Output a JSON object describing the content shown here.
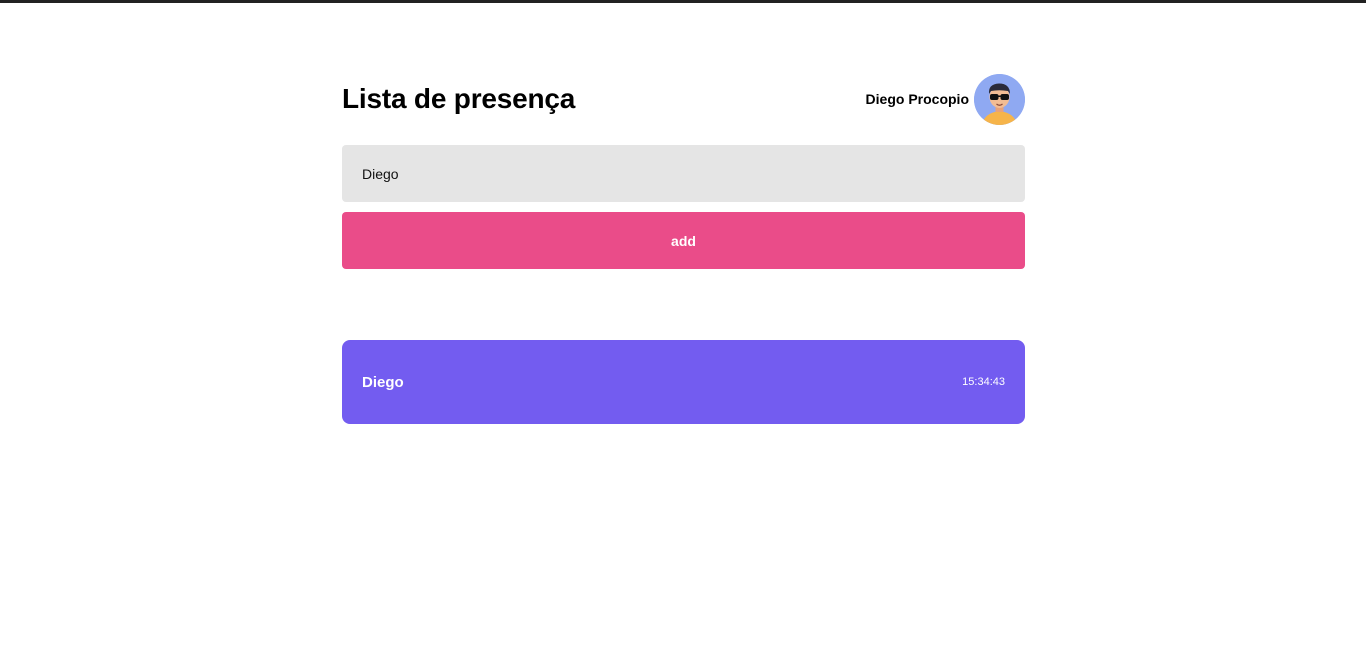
{
  "header": {
    "title": "Lista de presença",
    "user_name": "Diego Procopio",
    "avatar_icon": "avatar-sunglasses-icon"
  },
  "form": {
    "input_value": "Diego",
    "add_label": "add"
  },
  "cards": [
    {
      "name": "Diego",
      "time": "15:34:43"
    }
  ],
  "colors": {
    "accent_pink": "#ea4c89",
    "card_purple": "#735cf0",
    "input_bg": "#e5e5e5",
    "avatar_bg": "#8fa9f2"
  }
}
